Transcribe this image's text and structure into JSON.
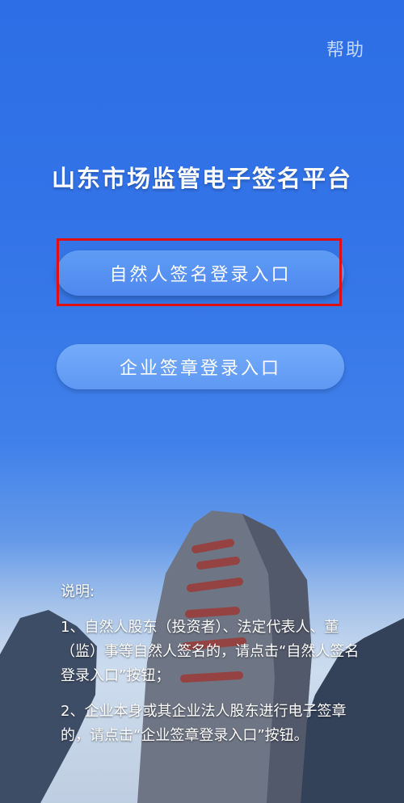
{
  "header": {
    "help_label": "帮助"
  },
  "page": {
    "title": "山东市场监管电子签名平台"
  },
  "buttons": {
    "natural_person_login": "自然人签名登录入口",
    "enterprise_login": "企业签章登录入口"
  },
  "notes": {
    "heading": "说明:",
    "item1": "1、自然人股东（投资者）、法定代表人、董（监）事等自然人签名的，请点击“自然人签名登录入口”按钮；",
    "item2": "2、企业本身或其企业法人股东进行电子签章的，请点击“企业签章登录入口”按钮。"
  },
  "colors": {
    "background_top": "#2d6ee6",
    "button_primary": "#5a95f3",
    "highlight_border": "#e01010",
    "text": "#ffffff"
  }
}
